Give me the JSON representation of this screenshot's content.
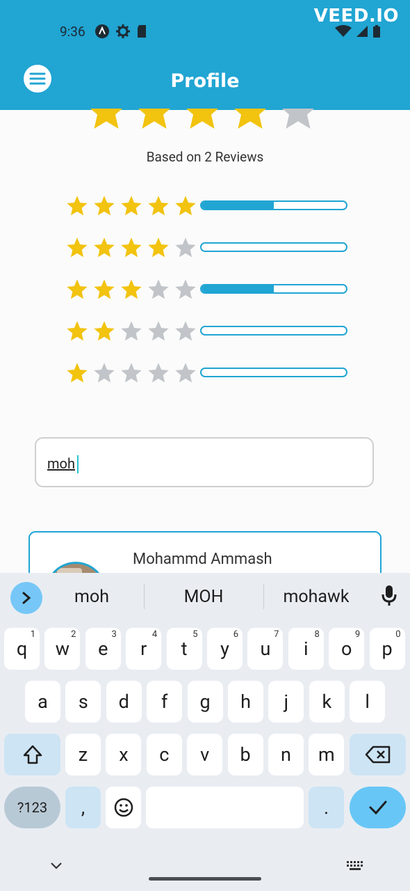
{
  "status_bar": {
    "time": "9:36"
  },
  "watermark": "VEED.IO",
  "app_bar": {
    "title": "Profile"
  },
  "rating": {
    "overall_stars": 4,
    "based_on": "Based on 2 Reviews",
    "distribution": [
      {
        "stars": 5,
        "fraction": 0.5
      },
      {
        "stars": 4,
        "fraction": 0.0
      },
      {
        "stars": 3,
        "fraction": 0.5
      },
      {
        "stars": 2,
        "fraction": 0.0
      },
      {
        "stars": 1,
        "fraction": 0.0
      }
    ]
  },
  "search": {
    "value": "moh"
  },
  "results": [
    {
      "name": "Mohammd Ammash"
    }
  ],
  "keyboard": {
    "suggestions": [
      "moh",
      "MOH",
      "mohawk"
    ],
    "row1": [
      {
        "k": "q",
        "h": "1"
      },
      {
        "k": "w",
        "h": "2"
      },
      {
        "k": "e",
        "h": "3"
      },
      {
        "k": "r",
        "h": "4"
      },
      {
        "k": "t",
        "h": "5"
      },
      {
        "k": "y",
        "h": "6"
      },
      {
        "k": "u",
        "h": "7"
      },
      {
        "k": "i",
        "h": "8"
      },
      {
        "k": "o",
        "h": "9"
      },
      {
        "k": "p",
        "h": "0"
      }
    ],
    "row2": [
      "a",
      "s",
      "d",
      "f",
      "g",
      "h",
      "j",
      "k",
      "l"
    ],
    "row3": [
      "z",
      "x",
      "c",
      "v",
      "b",
      "n",
      "m"
    ],
    "symbols_label": "?123",
    "comma": ",",
    "period": "."
  },
  "colors": {
    "accent": "#21a5d3",
    "star_filled": "#f2c30f",
    "star_empty": "#c1c4c8",
    "keyboard_bg": "#e9edf2"
  }
}
